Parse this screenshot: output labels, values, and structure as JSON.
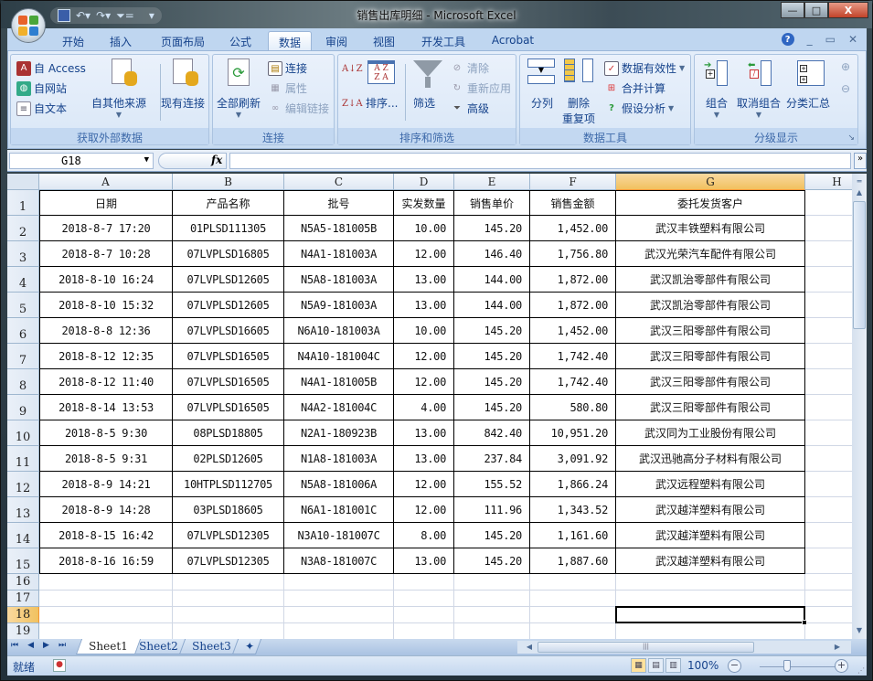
{
  "window": {
    "title": "销售出库明细 - Microsoft Excel",
    "minimize": "—",
    "maximize": "□",
    "close": "X"
  },
  "qat": {
    "save": "save-icon",
    "undo": "undo-icon",
    "redo": "redo-icon",
    "filter": "filter-icon",
    "customize": "customize-icon"
  },
  "ribbon_tabs": [
    {
      "label": "开始"
    },
    {
      "label": "插入"
    },
    {
      "label": "页面布局"
    },
    {
      "label": "公式"
    },
    {
      "label": "数据",
      "active": true
    },
    {
      "label": "审阅"
    },
    {
      "label": "视图"
    },
    {
      "label": "开发工具"
    },
    {
      "label": "Acrobat"
    }
  ],
  "ribbon": {
    "get_external": {
      "label": "获取外部数据",
      "access": "自 Access",
      "web": "自网站",
      "text": "自文本",
      "other": "自其他来源",
      "existing": "现有连接"
    },
    "connections": {
      "label": "连接",
      "refresh_all": "全部刷新",
      "connections": "连接",
      "properties": "属性",
      "edit_links": "编辑链接"
    },
    "sort_filter": {
      "label": "排序和筛选",
      "sort": "排序...",
      "filter": "筛选",
      "clear": "清除",
      "reapply": "重新应用",
      "advanced": "高级"
    },
    "data_tools": {
      "label": "数据工具",
      "text_to_columns": "分列",
      "remove_dup_1": "删除",
      "remove_dup_2": "重复项",
      "validation": "数据有效性",
      "consolidate": "合并计算",
      "what_if": "假设分析"
    },
    "outline": {
      "label": "分级显示",
      "group": "组合",
      "ungroup": "取消组合",
      "subtotal": "分类汇总"
    }
  },
  "formula_bar": {
    "name_box": "G18",
    "fx": "fx",
    "formula": ""
  },
  "columns": [
    "A",
    "B",
    "C",
    "D",
    "E",
    "F",
    "G",
    "H"
  ],
  "selected_column": "G",
  "selected_row": 18,
  "row_numbers": [
    1,
    2,
    3,
    4,
    5,
    6,
    7,
    8,
    9,
    10,
    11,
    12,
    13,
    14,
    15,
    16,
    17,
    18,
    19
  ],
  "table": {
    "headers": [
      "日期",
      "产品名称",
      "批号",
      "实发数量",
      "销售单价",
      "销售金额",
      "委托发货客户"
    ],
    "rows": [
      [
        "2018-8-7 17:20",
        "01PLSD111305",
        "N5A5-181005B",
        "10.00",
        "145.20",
        "1,452.00",
        "武汉丰铁塑料有限公司"
      ],
      [
        "2018-8-7 10:28",
        "07LVPLSD16805",
        "N4A1-181003A",
        "12.00",
        "146.40",
        "1,756.80",
        "武汉光荣汽车配件有限公司"
      ],
      [
        "2018-8-10 16:24",
        "07LVPLSD12605",
        "N5A8-181003A",
        "13.00",
        "144.00",
        "1,872.00",
        "武汉凯治零部件有限公司"
      ],
      [
        "2018-8-10 15:32",
        "07LVPLSD12605",
        "N5A9-181003A",
        "13.00",
        "144.00",
        "1,872.00",
        "武汉凯治零部件有限公司"
      ],
      [
        "2018-8-8 12:36",
        "07LVPLSD16605",
        "N6A10-181003A",
        "10.00",
        "145.20",
        "1,452.00",
        "武汉三阳零部件有限公司"
      ],
      [
        "2018-8-12 12:35",
        "07LVPLSD16505",
        "N4A10-181004C",
        "12.00",
        "145.20",
        "1,742.40",
        "武汉三阳零部件有限公司"
      ],
      [
        "2018-8-12 11:40",
        "07LVPLSD16505",
        "N4A1-181005B",
        "12.00",
        "145.20",
        "1,742.40",
        "武汉三阳零部件有限公司"
      ],
      [
        "2018-8-14 13:53",
        "07LVPLSD16505",
        "N4A2-181004C",
        "4.00",
        "145.20",
        "580.80",
        "武汉三阳零部件有限公司"
      ],
      [
        "2018-8-5 9:30",
        "08PLSD18805",
        "N2A1-180923B",
        "13.00",
        "842.40",
        "10,951.20",
        "武汉同为工业股份有限公司"
      ],
      [
        "2018-8-5 9:31",
        "02PLSD12605",
        "N1A8-181003A",
        "13.00",
        "237.84",
        "3,091.92",
        "武汉迅驰高分子材料有限公司"
      ],
      [
        "2018-8-9 14:21",
        "10HTPLSD112705",
        "N5A8-181006A",
        "12.00",
        "155.52",
        "1,866.24",
        "武汉远程塑料有限公司"
      ],
      [
        "2018-8-9 14:28",
        "03PLSD18605",
        "N6A1-181001C",
        "12.00",
        "111.96",
        "1,343.52",
        "武汉越洋塑料有限公司"
      ],
      [
        "2018-8-15 16:42",
        "07LVPLSD12305",
        "N3A10-181007C",
        "8.00",
        "145.20",
        "1,161.60",
        "武汉越洋塑料有限公司"
      ],
      [
        "2018-8-16 16:59",
        "07LVPLSD12305",
        "N3A8-181007C",
        "13.00",
        "145.20",
        "1,887.60",
        "武汉越洋塑料有限公司"
      ]
    ]
  },
  "sheets": [
    {
      "label": "Sheet1",
      "active": true
    },
    {
      "label": "Sheet2"
    },
    {
      "label": "Sheet3"
    }
  ],
  "status": {
    "ready": "就绪",
    "zoom": "100%"
  },
  "colors": {
    "accent": "#15428b",
    "selection_header": "#f1c15f",
    "ribbon_bg": "#d6e5f6"
  }
}
